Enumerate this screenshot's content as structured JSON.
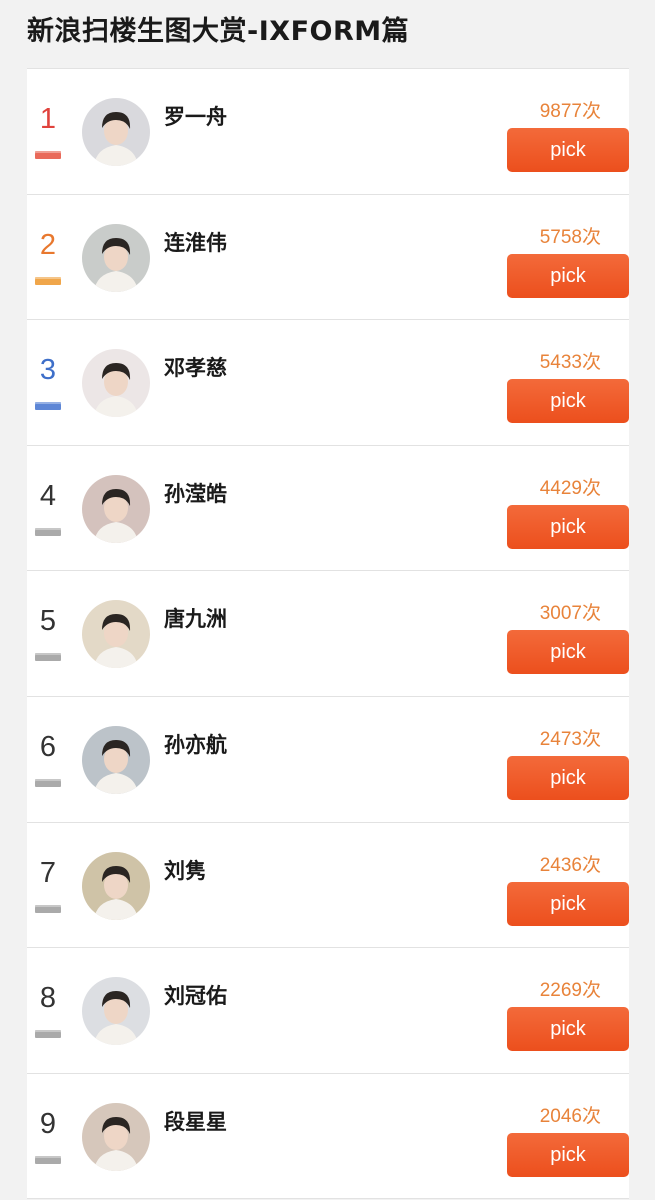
{
  "page": {
    "title": "新浪扫楼生图大赏-IXFORM篇"
  },
  "pick_label": "pick",
  "rank_colors": {
    "1": "#e96a5a",
    "2": "#f0a64a",
    "3": "#5d86d6",
    "default": "#aaaaaa"
  },
  "rank_number_colors": {
    "1": "#e0423c",
    "2": "#e8782e",
    "3": "#3e6fc9",
    "default": "#333333"
  },
  "entries": [
    {
      "rank": "1",
      "name": "罗一舟",
      "votes": "9877次",
      "avatar_bg": "#d9d9dd"
    },
    {
      "rank": "2",
      "name": "连淮伟",
      "votes": "5758次",
      "avatar_bg": "#c9ccca"
    },
    {
      "rank": "3",
      "name": "邓孝慈",
      "votes": "5433次",
      "avatar_bg": "#ece6e6"
    },
    {
      "rank": "4",
      "name": "孙滢皓",
      "votes": "4429次",
      "avatar_bg": "#d4c2bd"
    },
    {
      "rank": "5",
      "name": "唐九洲",
      "votes": "3007次",
      "avatar_bg": "#e3d9c7"
    },
    {
      "rank": "6",
      "name": "孙亦航",
      "votes": "2473次",
      "avatar_bg": "#bcc3c9"
    },
    {
      "rank": "7",
      "name": "刘隽",
      "votes": "2436次",
      "avatar_bg": "#cfc3a7"
    },
    {
      "rank": "8",
      "name": "刘冠佑",
      "votes": "2269次",
      "avatar_bg": "#dcdee2"
    },
    {
      "rank": "9",
      "name": "段星星",
      "votes": "2046次",
      "avatar_bg": "#d6c7bb"
    }
  ]
}
